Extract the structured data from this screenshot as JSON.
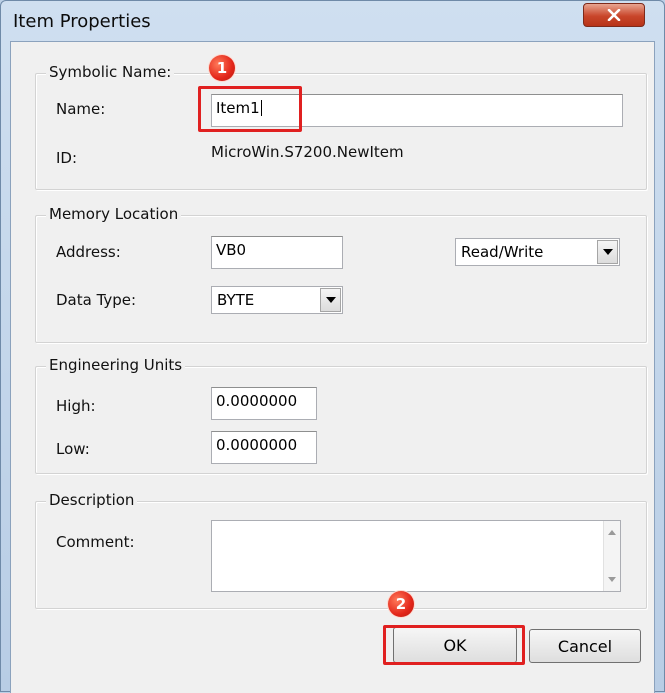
{
  "window": {
    "title": "Item Properties",
    "close_icon": "close-x-icon"
  },
  "symbolic_name": {
    "legend": "Symbolic Name:",
    "name_label": "Name:",
    "name_value": "Item1",
    "id_label": "ID:",
    "id_value": "MicroWin.S7200.NewItem"
  },
  "memory_location": {
    "legend": "Memory Location",
    "address_label": "Address:",
    "address_value": "VB0",
    "access_selected": "Read/Write",
    "data_type_label": "Data Type:",
    "data_type_selected": "BYTE"
  },
  "engineering_units": {
    "legend": "Engineering Units",
    "high_label": "High:",
    "high_value": "0.0000000",
    "low_label": "Low:",
    "low_value": "0.0000000"
  },
  "description": {
    "legend": "Description",
    "comment_label": "Comment:",
    "comment_value": ""
  },
  "buttons": {
    "ok": "OK",
    "cancel": "Cancel"
  },
  "annotations": {
    "step1": "1",
    "step2": "2",
    "highlight_color": "#e02020"
  }
}
